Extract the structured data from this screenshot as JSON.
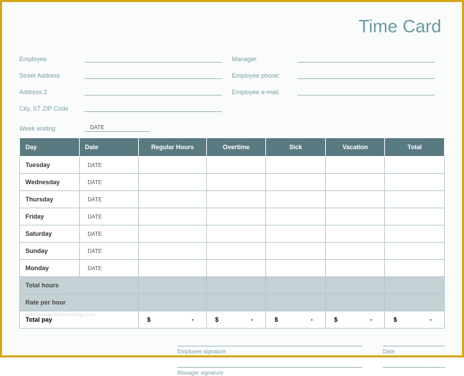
{
  "title": "Time Card",
  "fields": {
    "employee": "Employee",
    "street": "Street Address",
    "address2": "Address 2",
    "citystzip": "City, ST  ZIP Code",
    "manager": "Manager:",
    "phone": "Employee phone:",
    "email": "Employee e-mail:",
    "week_ending": "Week ending:",
    "week_ending_val": "DATE"
  },
  "headers": {
    "day": "Day",
    "date": "Date",
    "regular": "Regular Hours",
    "overtime": "Overtime",
    "sick": "Sick",
    "vacation": "Vacation",
    "total": "Total"
  },
  "rows": [
    {
      "day": "Tuesday",
      "date": "DATE"
    },
    {
      "day": "Wednesday",
      "date": "DATE"
    },
    {
      "day": "Thursday",
      "date": "DATE"
    },
    {
      "day": "Friday",
      "date": "DATE"
    },
    {
      "day": "Saturday",
      "date": "DATE"
    },
    {
      "day": "Sunday",
      "date": "DATE"
    },
    {
      "day": "Monday",
      "date": "DATE"
    }
  ],
  "summary": {
    "total_hours": "Total hours",
    "rate_per_hour": "Rate per hour",
    "total_pay": "Total pay",
    "dollar": "$",
    "dash": "-"
  },
  "signatures": {
    "emp_sig": "Employee signature",
    "mgr_sig": "Manager signature",
    "date": "Date"
  },
  "watermark": "www.heritagechristiancollege.com"
}
